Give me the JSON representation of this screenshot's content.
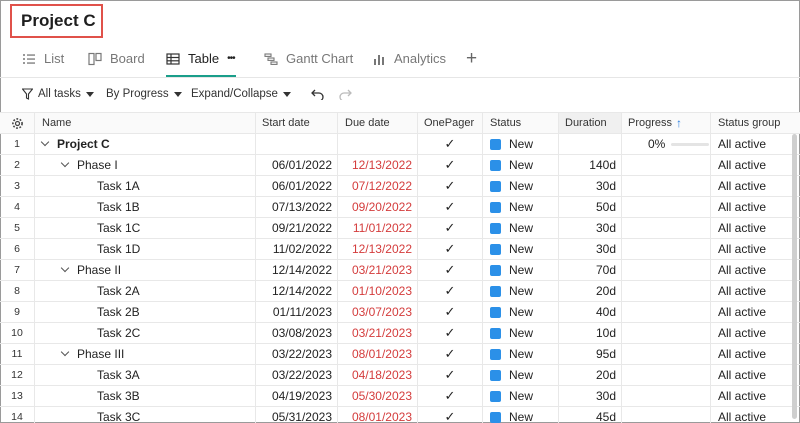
{
  "project": {
    "title": "Project C"
  },
  "tabs": [
    {
      "label": "List",
      "icon": "list-icon"
    },
    {
      "label": "Board",
      "icon": "board-icon"
    },
    {
      "label": "Table",
      "icon": "table-icon",
      "active": true,
      "more": "•••"
    },
    {
      "label": "Gantt Chart",
      "icon": "gantt-icon"
    },
    {
      "label": "Analytics",
      "icon": "analytics-icon"
    }
  ],
  "add_tab": "+",
  "toolbar": {
    "filter_label": "All tasks",
    "group_label": "By Progress",
    "expand_label": "Expand/Collapse",
    "undo_icon": "undo-icon",
    "redo_icon": "redo-icon"
  },
  "columns": {
    "name": "Name",
    "start": "Start date",
    "due": "Due date",
    "onepager": "OnePager",
    "status": "Status",
    "duration": "Duration",
    "progress": "Progress",
    "status_group": "Status group"
  },
  "colors": {
    "accent": "#1a9e8a",
    "status_new": "#2b90e8",
    "overdue": "#d43c3c",
    "highlight": "#e0514a"
  },
  "rows": [
    {
      "num": "1",
      "name": "Project C",
      "level": 0,
      "chevron": true,
      "start": "",
      "due": "",
      "check": "✓",
      "status": "New",
      "duration": "",
      "progress": "0%",
      "progress_value": 0,
      "group": "All active"
    },
    {
      "num": "2",
      "name": "Phase I",
      "level": 1,
      "chevron": true,
      "start": "06/01/2022",
      "due": "12/13/2022",
      "check": "✓",
      "status": "New",
      "duration": "140d",
      "progress": "",
      "group": "All active"
    },
    {
      "num": "3",
      "name": "Task 1A",
      "level": 2,
      "start": "06/01/2022",
      "due": "07/12/2022",
      "check": "✓",
      "status": "New",
      "duration": "30d",
      "progress": "",
      "group": "All active"
    },
    {
      "num": "4",
      "name": "Task 1B",
      "level": 2,
      "start": "07/13/2022",
      "due": "09/20/2022",
      "check": "✓",
      "status": "New",
      "duration": "50d",
      "progress": "",
      "group": "All active"
    },
    {
      "num": "5",
      "name": "Task 1C",
      "level": 2,
      "start": "09/21/2022",
      "due": "11/01/2022",
      "check": "✓",
      "status": "New",
      "duration": "30d",
      "progress": "",
      "group": "All active"
    },
    {
      "num": "6",
      "name": "Task 1D",
      "level": 2,
      "start": "11/02/2022",
      "due": "12/13/2022",
      "check": "✓",
      "status": "New",
      "duration": "30d",
      "progress": "",
      "group": "All active"
    },
    {
      "num": "7",
      "name": "Phase II",
      "level": 1,
      "chevron": true,
      "start": "12/14/2022",
      "due": "03/21/2023",
      "check": "✓",
      "status": "New",
      "duration": "70d",
      "progress": "",
      "group": "All active"
    },
    {
      "num": "8",
      "name": "Task 2A",
      "level": 2,
      "start": "12/14/2022",
      "due": "01/10/2023",
      "check": "✓",
      "status": "New",
      "duration": "20d",
      "progress": "",
      "group": "All active"
    },
    {
      "num": "9",
      "name": "Task 2B",
      "level": 2,
      "start": "01/11/2023",
      "due": "03/07/2023",
      "check": "✓",
      "status": "New",
      "duration": "40d",
      "progress": "",
      "group": "All active"
    },
    {
      "num": "10",
      "name": "Task 2C",
      "level": 2,
      "start": "03/08/2023",
      "due": "03/21/2023",
      "check": "✓",
      "status": "New",
      "duration": "10d",
      "progress": "",
      "group": "All active"
    },
    {
      "num": "11",
      "name": "Phase III",
      "level": 1,
      "chevron": true,
      "start": "03/22/2023",
      "due": "08/01/2023",
      "check": "✓",
      "status": "New",
      "duration": "95d",
      "progress": "",
      "group": "All active"
    },
    {
      "num": "12",
      "name": "Task 3A",
      "level": 2,
      "start": "03/22/2023",
      "due": "04/18/2023",
      "check": "✓",
      "status": "New",
      "duration": "20d",
      "progress": "",
      "group": "All active"
    },
    {
      "num": "13",
      "name": "Task 3B",
      "level": 2,
      "start": "04/19/2023",
      "due": "05/30/2023",
      "check": "✓",
      "status": "New",
      "duration": "30d",
      "progress": "",
      "group": "All active"
    },
    {
      "num": "14",
      "name": "Task 3C",
      "level": 2,
      "start": "05/31/2023",
      "due": "08/01/2023",
      "check": "✓",
      "status": "New",
      "duration": "45d",
      "progress": "",
      "group": "All active"
    }
  ]
}
